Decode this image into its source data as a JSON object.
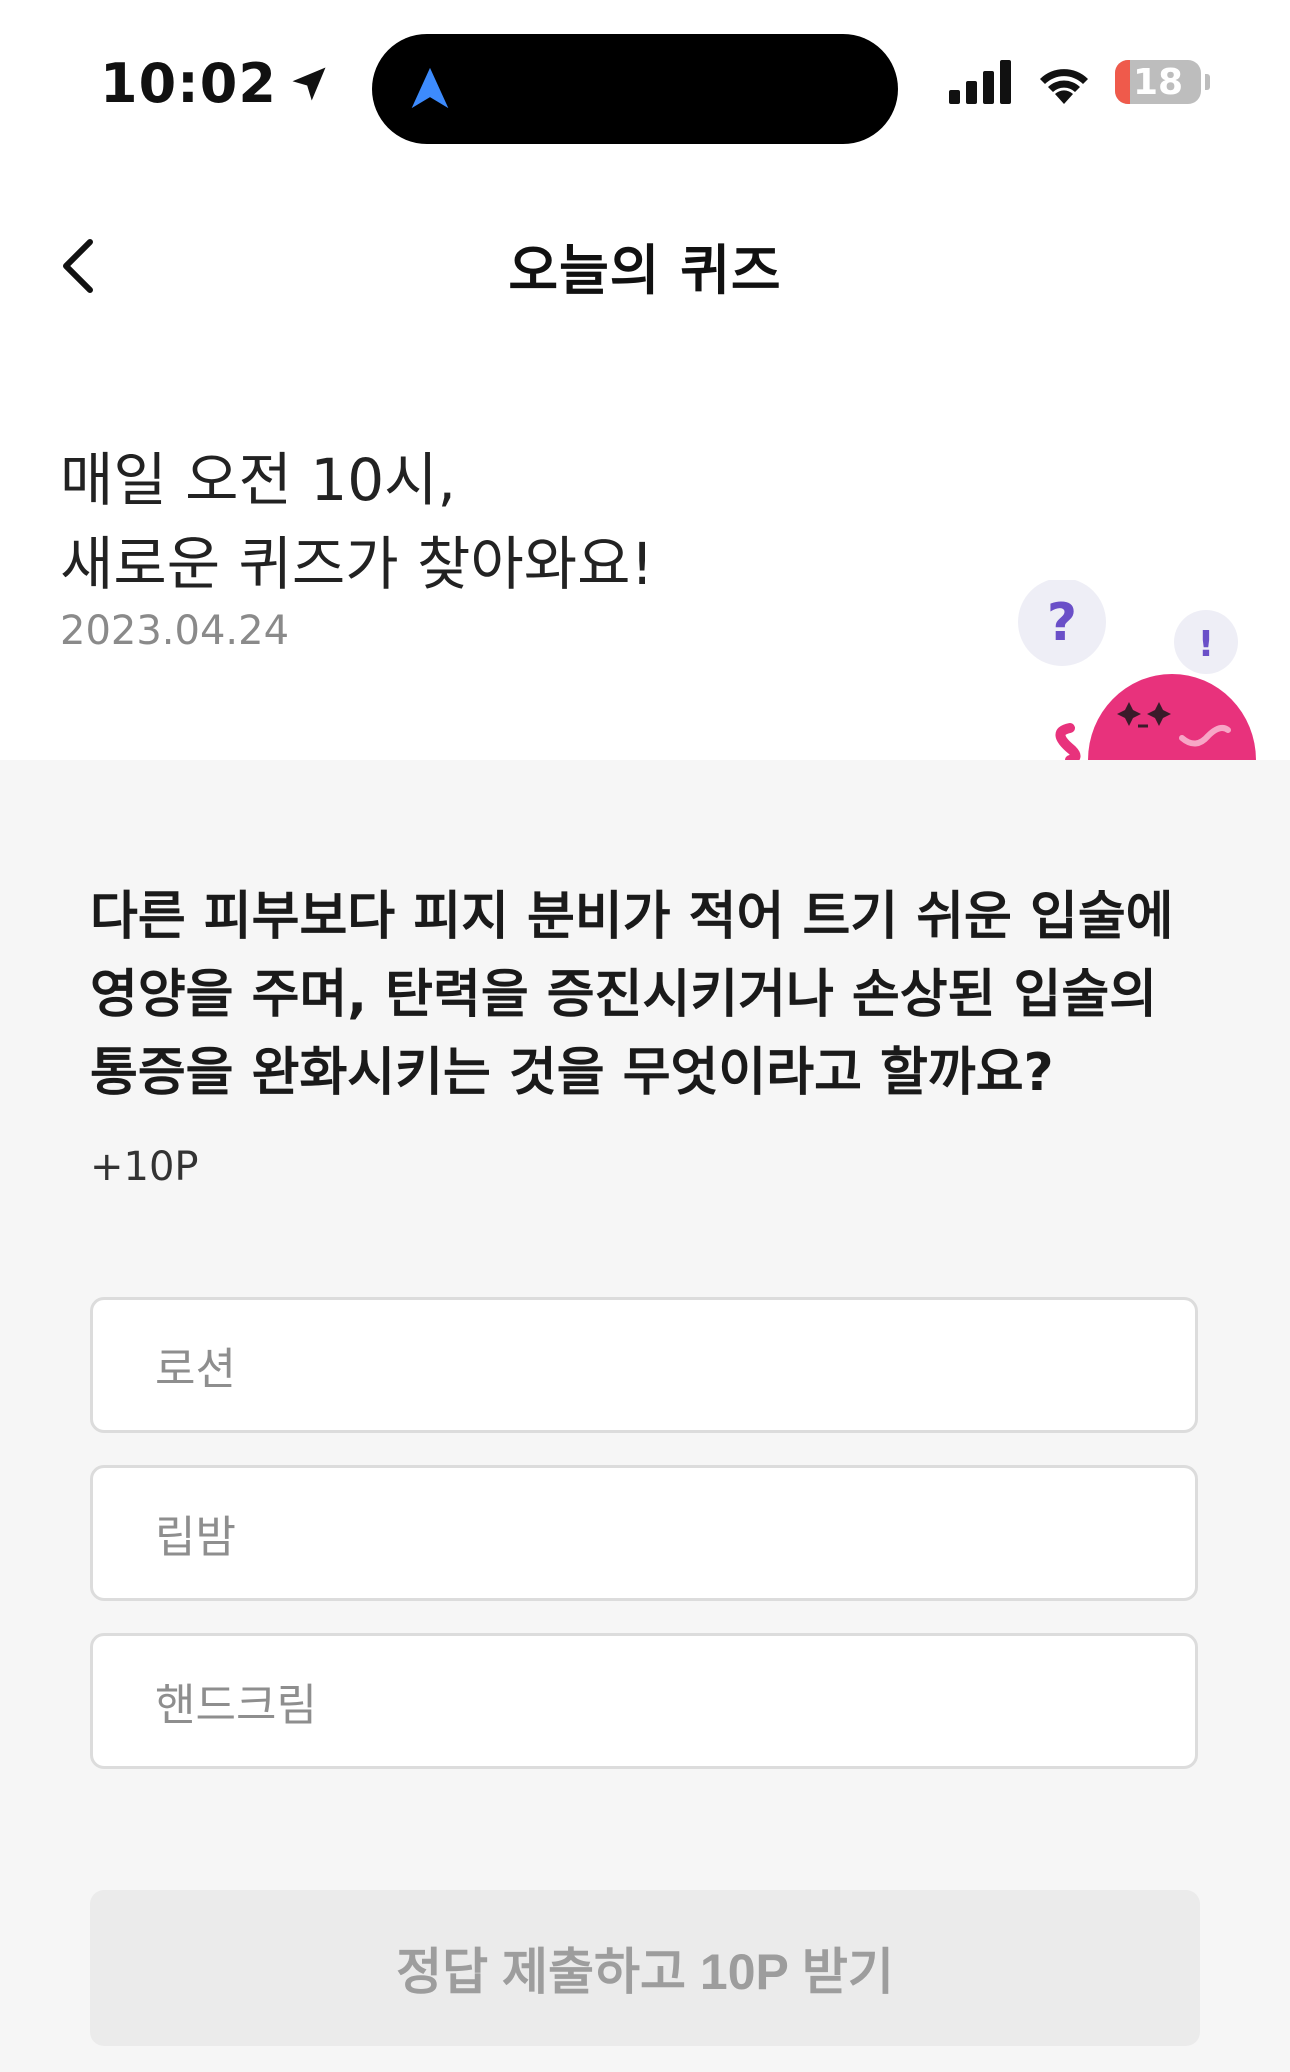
{
  "status_bar": {
    "time": "10:02",
    "battery": "18",
    "battery_level": 0.18
  },
  "nav": {
    "title": "오늘의 퀴즈"
  },
  "hero": {
    "title_line1": "매일 오전 10시,",
    "title_line2": "새로운 퀴즈가 찾아와요!",
    "date": "2023.04.24",
    "mascot_bubble_q": "?",
    "mascot_bubble_ex": "!"
  },
  "quiz": {
    "question_line1": "다른 피부보다 피지 분비가 적어 트기 쉬운 입술에",
    "question_line2": "영양을 주며, 탄력을 증진시키거나 손상된 입술의",
    "question_line3": "통증을 완화시키는 것을 무엇이라고 할까요?",
    "points": "+10P",
    "options": [
      "로션",
      "립밤",
      "핸드크림"
    ],
    "submit_label": "정답 제출하고 10P 받기"
  },
  "colors": {
    "background": "#ffffff",
    "quiz_background": "#f6f6f6",
    "mascot_pink": "#e8327c",
    "battery_red": "#ef5a4b",
    "nav_arrow_blue": "#3d8bfd",
    "bubble_purple": "#6a4fc8"
  }
}
